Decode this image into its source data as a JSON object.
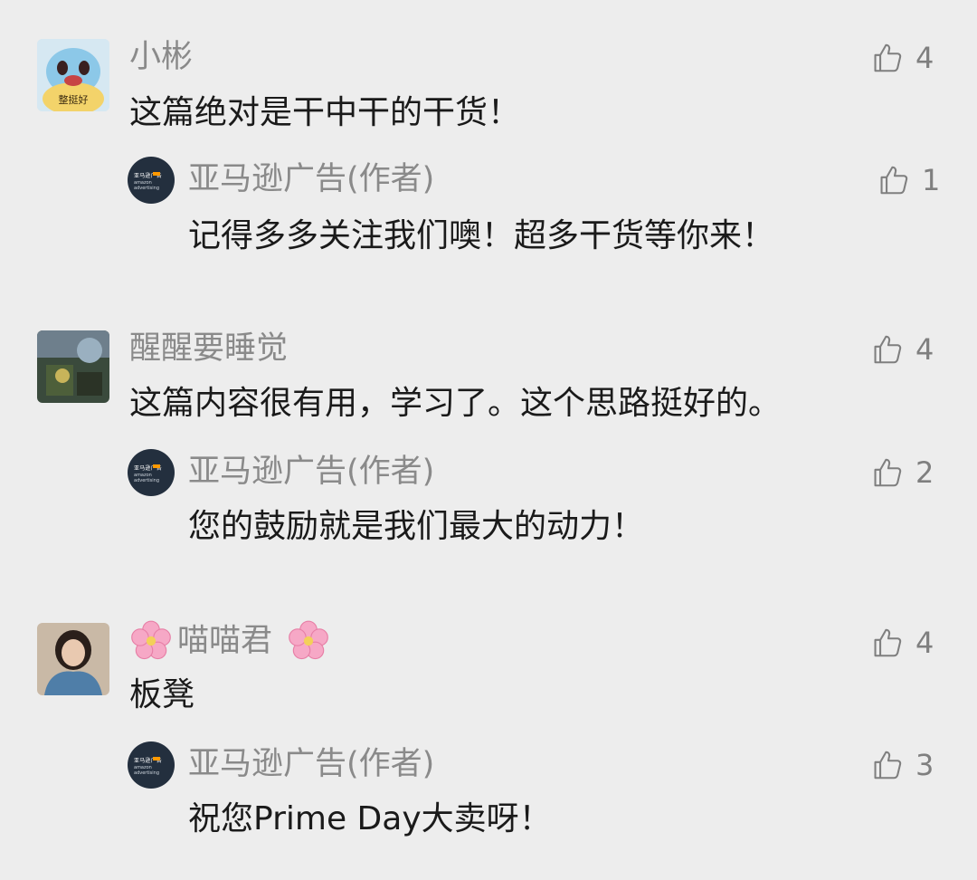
{
  "comments": [
    {
      "nickname": "小彬",
      "text": "这篇绝对是干中干的干货！",
      "likes": "4",
      "avatar_sticker": "整挺好",
      "reply": {
        "nickname": "亚马逊广告(作者)",
        "text": "记得多多关注我们噢！超多干货等你来！",
        "likes": "1"
      }
    },
    {
      "nickname": "醒醒要睡觉",
      "text": "这篇内容很有用，学习了。这个思路挺好的。",
      "likes": "4",
      "reply": {
        "nickname": "亚马逊广告(作者)",
        "text": "您的鼓励就是我们最大的动力！",
        "likes": "2"
      }
    },
    {
      "nickname": "喵喵君",
      "text": "板凳",
      "likes": "4",
      "reply": {
        "nickname": "亚马逊广告(作者)",
        "text": "祝您Prime Day大卖呀！",
        "likes": "3"
      }
    }
  ],
  "author_avatar_text": "亚马逊广告",
  "author_avatar_sub": "amazon advertising",
  "icons": {
    "like": "thumbs-up-icon",
    "flower": "cherry-blossom-icon"
  },
  "colors": {
    "background": "#ededed",
    "nickname": "#8a8a8a",
    "text": "#1a1a1a",
    "like": "#7f7f7f"
  }
}
